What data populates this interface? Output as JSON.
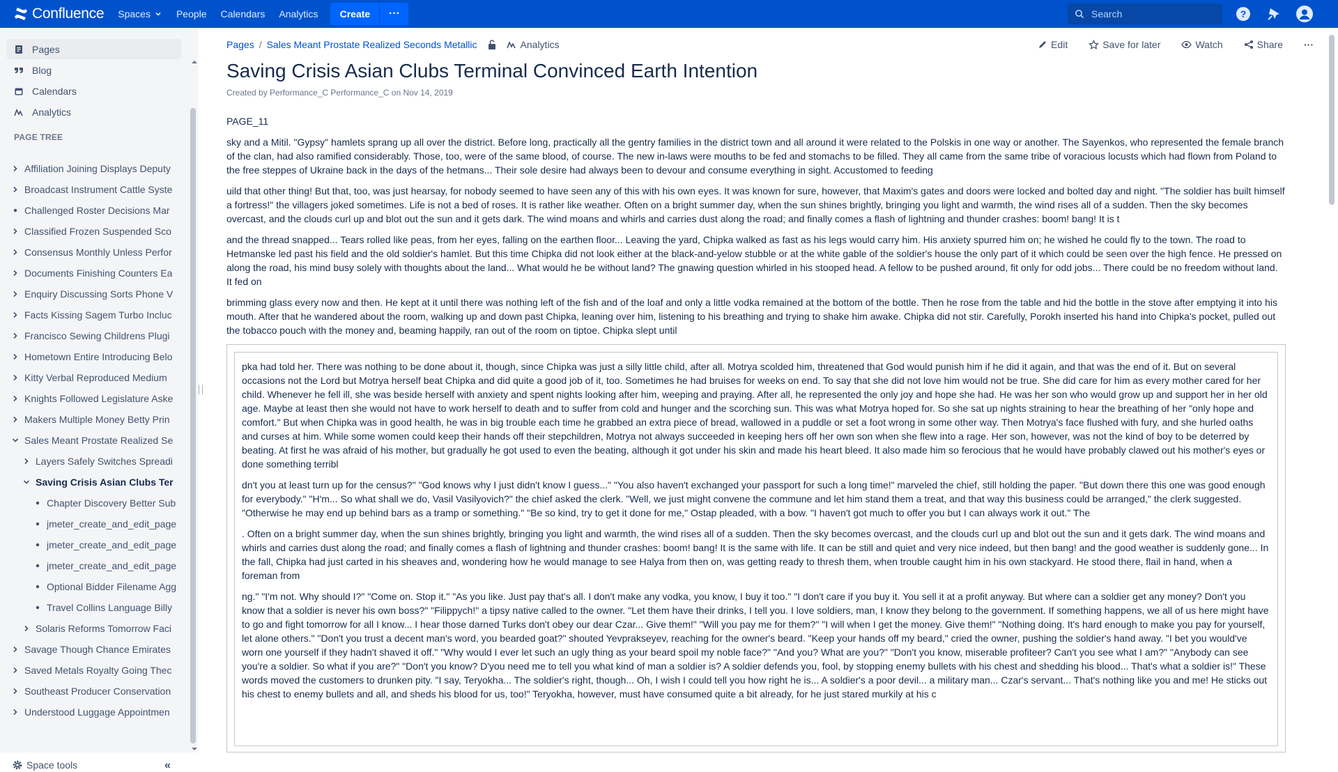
{
  "topnav": {
    "logo": "Confluence",
    "links": [
      "Spaces",
      "People",
      "Calendars",
      "Analytics"
    ],
    "create_label": "Create",
    "more_label": "···",
    "search_placeholder": "Search"
  },
  "sidebar": {
    "items": [
      {
        "label": "Pages",
        "icon": "pages-icon"
      },
      {
        "label": "Blog",
        "icon": "quote-icon"
      },
      {
        "label": "Calendars",
        "icon": "calendar-icon"
      },
      {
        "label": "Analytics",
        "icon": "analytics-icon"
      }
    ],
    "page_tree_header": "PAGE TREE",
    "tree": [
      {
        "label": "Affiliation Joining Displays Deputy",
        "level": 0,
        "marker": "chevron-right"
      },
      {
        "label": "Broadcast Instrument Cattle Syste",
        "level": 0,
        "marker": "chevron-right"
      },
      {
        "label": "Challenged Roster Decisions Mar",
        "level": 0,
        "marker": "bullet"
      },
      {
        "label": "Classified Frozen Suspended Sco",
        "level": 0,
        "marker": "chevron-right"
      },
      {
        "label": "Consensus Monthly Unless Perfor",
        "level": 0,
        "marker": "chevron-right"
      },
      {
        "label": "Documents Finishing Counters Ea",
        "level": 0,
        "marker": "chevron-right"
      },
      {
        "label": "Enquiry Discussing Sorts Phone V",
        "level": 0,
        "marker": "chevron-right"
      },
      {
        "label": "Facts Kissing Sagem Turbo Incluc",
        "level": 0,
        "marker": "chevron-right"
      },
      {
        "label": "Francisco Sewing Childrens Plugi",
        "level": 0,
        "marker": "chevron-right"
      },
      {
        "label": "Hometown Entire Introducing Belo",
        "level": 0,
        "marker": "chevron-right"
      },
      {
        "label": "Kitty Verbal Reproduced Medium",
        "level": 0,
        "marker": "chevron-right"
      },
      {
        "label": "Knights Followed Legislature Aske",
        "level": 0,
        "marker": "chevron-right"
      },
      {
        "label": "Makers Multiple Money Betty Prin",
        "level": 0,
        "marker": "chevron-right"
      },
      {
        "label": "Sales Meant Prostate Realized Se",
        "level": 0,
        "marker": "chevron-down"
      },
      {
        "label": "Layers Safely Switches Spreadi",
        "level": 1,
        "marker": "chevron-right"
      },
      {
        "label": "Saving Crisis Asian Clubs Ter",
        "level": 1,
        "marker": "chevron-down",
        "current": true
      },
      {
        "label": "Chapter Discovery Better Sub",
        "level": 2,
        "marker": "bullet"
      },
      {
        "label": "jmeter_create_and_edit_page",
        "level": 2,
        "marker": "bullet"
      },
      {
        "label": "jmeter_create_and_edit_page",
        "level": 2,
        "marker": "bullet"
      },
      {
        "label": "jmeter_create_and_edit_page",
        "level": 2,
        "marker": "bullet"
      },
      {
        "label": "Optional Bidder Filename Agg",
        "level": 2,
        "marker": "bullet"
      },
      {
        "label": "Travel Collins Language Billy",
        "level": 2,
        "marker": "bullet"
      },
      {
        "label": "Solaris Reforms Tomorrow Faci",
        "level": 1,
        "marker": "chevron-right"
      },
      {
        "label": "Savage Though Chance Emirates",
        "level": 0,
        "marker": "chevron-right"
      },
      {
        "label": "Saved Metals Royalty Going Thec",
        "level": 0,
        "marker": "chevron-right"
      },
      {
        "label": "Southeast Producer Conservation",
        "level": 0,
        "marker": "chevron-right"
      },
      {
        "label": "Understood Luggage Appointmen",
        "level": 0,
        "marker": "chevron-right"
      }
    ],
    "space_tools": "Space tools",
    "collapse_label": "«"
  },
  "main": {
    "breadcrumb": [
      "Pages",
      "Sales Meant Prostate Realized Seconds Metallic"
    ],
    "breadcrumb_separator": "/",
    "analytics_label": "Analytics",
    "actions": {
      "edit": "Edit",
      "save_for_later": "Save for later",
      "watch": "Watch",
      "share": "Share",
      "more": "···"
    },
    "title": "Saving Crisis Asian Clubs Terminal Convinced Earth Intention",
    "byline": "Created by Performance_C Performance_C on Nov 14, 2019",
    "paragraphs": [
      "PAGE_11",
      "sky and a Mitil. \"Gypsy\" hamlets sprang up all over the district. Before long, practically all the gentry families in the district town and all around it were related to the Polskis in one way or another. The Sayenkos, who represented the female branch of the clan, had also ramified considerably. Those, too, were of the same blood, of course. The new in-laws were mouths to be fed and stomachs to be filled. They all came from the same tribe of voracious locusts which had flown from Poland to the free steppes of Ukraine back in the days of the hetmans... Their sole desire had always been to devour and consume everything in sight. Accustomed to feeding",
      "uild that other thing! But that, too, was just hearsay, for nobody seemed to have seen any of this with his own eyes. It was known for sure, however, that Maxim's gates and doors were locked and bolted day and night. \"The soldier has built himself a fortress!\" the villagers joked sometimes. Life is not a bed of roses. It is rather like weather. Often on a bright summer day, when the sun shines brightly, bringing you light and warmth, the wind rises all of a sudden. Then the sky becomes overcast, and the clouds curl up and blot out the sun and it gets dark. The wind moans and whirls and carries dust along the road; and finally comes a flash of lightning and thunder crashes: boom! bang! It is t",
      "and the thread snapped... Tears rolled like peas, from her eyes, falling on the earthen floor... Leaving the yard, Chipka walked as fast as his legs would carry him. His anxiety spurred him on; he wished he could fly to the town. The road to Hetmanske led past his field and the old soldier's hamlet. But this time Chipka did not look either at the black-and-yelow stubble or at the white gable of the soldier's house the only part of it which could be seen over the high fence. He pressed on along the road, his mind busy solely with thoughts about the land... What would he be without land? The gnawing question whirled in his stooped head. A fellow to be pushed around, fit only for odd jobs... There could be no freedom without land. It fed on",
      "brimming glass every now and then. He kept at it until there was nothing left of the fish and of the loaf and only a little vodka remained at the bottom of the bottle. Then he rose from the table and hid the bottle in the stove after emptying it into his mouth. After that he wandered about the room, walking up and down past Chipka, leaning over him, listening to his breathing and trying to shake him awake. Chipka did not stir. Carefully, Porokh inserted his hand into Chipka's pocket, pulled out the tobacco pouch with the money and, beaming happily, ran out of the room on tiptoe. Chipka slept until"
    ],
    "panel_paragraphs": [
      "pka had told her. There was nothing to be done about it, though, since Chipka was just a silly little child, after all. Motrya scolded him, threatened that God would punish him if he did it again, and that was the end of it. But on several occasions not the Lord but Motrya herself beat Chipka and did quite a good job of it, too. Sometimes he had bruises for weeks on end. To say that she did not love him would not be true. She did care for him as every mother cared for her child. Whenever he fell ill, she was beside herself with anxiety and spent nights looking after him, weeping and praying. After all, he represented the only joy and hope she had. He was her son who would grow up and support her in her old age. Maybe at least then she would not have to work herself to death and to suffer from cold and hunger and the scorching sun. This was what Motrya hoped for. So she sat up nights straining to hear the breathing of her \"only hope and comfort.\" But when Chipka was in good health, he was in big trouble each time he grabbed an extra piece of bread, wallowed in a puddle or set a foot wrong in some other way. Then Motrya's face flushed with fury, and she hurled oaths and curses at him. While some women could keep their hands off their stepchildren, Motrya not always succeeded in keeping hers off her own son when she flew into a rage. Her son, however, was not the kind of boy to be deterred by beating. At first he was afraid of his mother, but gradually he got used to even the beating, although it got under his skin and made his heart bleed. It also made him so ferocious that he would have probably clawed out his mother's eyes or done something terribl",
      "dn't you at least turn up for the census?\" \"God knows why I just didn't know I guess...\" \"You also haven't exchanged your passport for such a long time!\" marveled the chief, still holding the paper. \"But down there this one was good enough for everybody.\" \"H'm... So what shall we do, Vasil Vasilyovich?\" the chief asked the clerk. \"Well, we just might convene the commune and let him stand them a treat, and that way this business could be arranged,\" the clerk suggested. \"Otherwise he may end up behind bars as a tramp or something.\" \"Be so kind, try to get it done for me,\" Ostap pleaded, with a bow. \"I haven't got much to offer you but I can always work it out.\" The",
      ". Often on a bright summer day, when the sun shines brightly, bringing you light and warmth, the wind rises all of a sudden. Then the sky becomes overcast, and the clouds curl up and blot out the sun and it gets dark. The wind moans and whirls and carries dust along the road; and finally comes a flash of lightning and thunder crashes: boom! bang! It is the same with life. It can be still and quiet and very nice indeed, but then bang! and the good weather is suddenly gone... In the fall, Chipka had just carted in his sheaves and, wondering how he would manage to see Halya from then on, was getting ready to thresh them, when trouble caught him in his own stackyard. He stood there, flail in hand, when a foreman from",
      "ng.\" \"I'm not. Why should I?\" \"Come on. Stop it.\" \"As you like. Just pay that's all. I don't make any vodka, you know, I buy it too.\" \"I don't care if you buy it. You sell it at a profit anyway. But where can a soldier get any money? Don't you know that a soldier is never his own boss?\" \"Filippych!\" a tipsy native called to the owner. \"Let them have their drinks, I tell you. I love soldiers, man, I know they belong to the government. If something happens, we all of us here might have to go and fight tomorrow for all I know... I hear those darned Turks don't obey our dear Czar... Give them!\" \"Will you pay me for them?\" \"I will when I get the money. Give them!\" \"Nothing doing. It's hard enough to make you pay for yourself, let alone others.\" \"Don't you trust a decent man's word, you bearded goat?\" shouted Yevprakseyev, reaching for the owner's beard. \"Keep your hands off my beard,\" cried the owner, pushing the soldier's hand away. \"I bet you would've worn one yourself if they hadn't shaved it off.\" \"Why would I ever let such an ugly thing as your beard spoil my noble face?\" \"And you? What are you?\" \"Don't you know, miserable profiteer? Can't you see what I am?\" \"Anybody can see you're a soldier. So what if you are?\" \"Don't you know? D'you need me to tell you what kind of man a soldier is? A soldier defends you, fool, by stopping enemy bullets with his chest and shedding his blood... That's what a soldier is!\" These words moved the customers to drunken pity. \"I say, Teryokha... The soldier's right, though... Oh, I wish I could tell you how right he is... A soldier's a poor devil... a military man... Czar's servant... That's nothing like you and me! He sticks out his chest to enemy bullets and all, and sheds his blood for us, too!\" Teryokha, however, must have consumed quite a bit already, for he just stared murkily at his c"
    ]
  },
  "colors": {
    "nav_bg": "#0052cc",
    "create_bg": "#0065ff",
    "sidebar_bg": "#f4f5f7",
    "link": "#0052cc",
    "text": "#172b4d"
  }
}
